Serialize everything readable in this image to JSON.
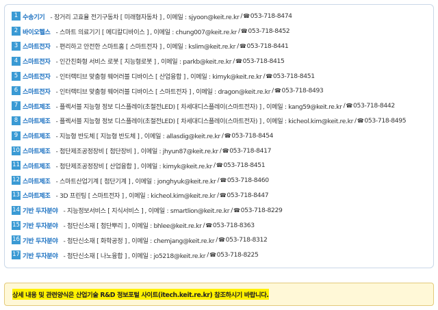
{
  "contacts": [
    {
      "num": "1",
      "category": "수송기기",
      "desc": "- 장거리 고효율 전기구동차 [ 미래형자동차 ]",
      "email": ", 이메일 : sjyoon@keit.re.kr",
      "phone_prefix": "/",
      "phone": "053-718-8474"
    },
    {
      "num": "2",
      "category": "바이오헬스",
      "desc": "- 스마트 의료기기 [ 메디칼디바이스 ]",
      "email": ", 이메일 : chung007@keit.re.kr",
      "phone_prefix": "/",
      "phone": "053-718-8452"
    },
    {
      "num": "3",
      "category": "스마트전자",
      "desc": "- 편리하고 안전한 스마트홈 [ 스마트전자 ]",
      "email": ", 이메일 : kslim@keit.re.kr",
      "phone_prefix": "/",
      "phone": "053-718-8441"
    },
    {
      "num": "4",
      "category": "스마트전자",
      "desc": "- 인간친화형 서비스 로봇 [ 지능형로봇 ]",
      "email": ", 이메일 : parkb@keit.re.kr",
      "phone_prefix": "/",
      "phone": "053-718-8415"
    },
    {
      "num": "5",
      "category": "스마트전자",
      "desc": "- 인터랙티브 맞춤형 웨어러블 디바이스 [ 산업융합 ]",
      "email": ", 이메일 : kimyk@keit.re.kr",
      "phone_prefix": "/",
      "phone": "053-718-8451"
    },
    {
      "num": "6",
      "category": "스마트전자",
      "desc": "- 인터랙티브 맞춤형 웨어러블 디바이스 [ 스마트전자 ]",
      "email": ", 이메일 : dragon@keit.re.kr",
      "phone_prefix": "/",
      "phone": "053-718-8493"
    },
    {
      "num": "7",
      "category": "스마트제조",
      "desc": "- 플렉서블 지능형 정보 디스플레이(초절전LED) [ 차세대디스플레이(스마트전자) ]",
      "email": ", 이메일 : kang59@keit.re.kr",
      "phone_prefix": "/",
      "phone": "053-718-8442"
    },
    {
      "num": "8",
      "category": "스마트제조",
      "desc": "- 플렉서블 지능형 정보 디스플레이(초절전LED) [ 차세대디스플레이(스마트전자) ]",
      "email": ", 이메일 : kicheol.kim@keit.re.kr",
      "phone_prefix": "/",
      "phone": "053-718-8495"
    },
    {
      "num": "9",
      "category": "스마트제조",
      "desc": "- 지능형 반도체 [ 지능형 반도체 ]",
      "email": ", 이메일 : allasdig@keit.re.kr",
      "phone_prefix": "/",
      "phone": "053-718-8454"
    },
    {
      "num": "10",
      "category": "스마트제조",
      "desc": "- 첨단제조공정장비 [ 첨단장비 ]",
      "email": ", 이메일 : jhyun87@keit.re.kr",
      "phone_prefix": "/",
      "phone": "053-718-8417"
    },
    {
      "num": "11",
      "category": "스마트제조",
      "desc": "- 첨단제조공정장비 [ 산업융합 ]",
      "email": ", 이메일 : kimyk@keit.re.kr",
      "phone_prefix": "/",
      "phone": "053-718-8451"
    },
    {
      "num": "12",
      "category": "스마트제조",
      "desc": "- 스마트산업기계 [ 첨단기계 ]",
      "email": ", 이메일 : jonghyuk@keit.re.kr",
      "phone_prefix": "/",
      "phone": "053-718-8460"
    },
    {
      "num": "13",
      "category": "스마트제조",
      "desc": "- 3D 프린팅 [ 스마트전자 ]",
      "email": ", 이메일 : kicheol.kim@keit.re.kr",
      "phone_prefix": "/",
      "phone": "053-718-8447"
    },
    {
      "num": "14",
      "category": "기반 두자분야",
      "desc": "- 지능정보서비스 [ 지식서비스 ]",
      "email": ", 이메일 : smartlion@keit.re.kr",
      "phone_prefix": "/",
      "phone": "053-718-8229"
    },
    {
      "num": "15",
      "category": "기반 두자분야",
      "desc": "- 첨단신소재 [ 첨단뿌리 ]",
      "email": ", 이메일 : bhlee@keit.re.kr",
      "phone_prefix": "/",
      "phone": "053-718-8363"
    },
    {
      "num": "16",
      "category": "기반 두자분야",
      "desc": "- 첨단신소재 [ 화학공정 ]",
      "email": ", 이메일 : chemjang@keit.re.kr",
      "phone_prefix": "/",
      "phone": "053-718-8312"
    },
    {
      "num": "17",
      "category": "기반 두자분야",
      "desc": "- 첨단신소재 [ 나노융합 ]",
      "email": ", 이메일 : jo5218@keit.re.kr",
      "phone_prefix": "/",
      "phone": "053-718-8225"
    }
  ],
  "icons": {
    "phone": "phone-icon"
  },
  "colors": {
    "number_badge": "#3a9ad4",
    "category_text": "#1f73c2",
    "note_highlight": "#fff100",
    "note_background": "#fff8d7"
  },
  "notice": {
    "text": "상세 내용 및 관련양식은 산업기술 R&D 정보포털 사이트(itech.keit.re.kr) 참조하시기 바랍니다."
  }
}
